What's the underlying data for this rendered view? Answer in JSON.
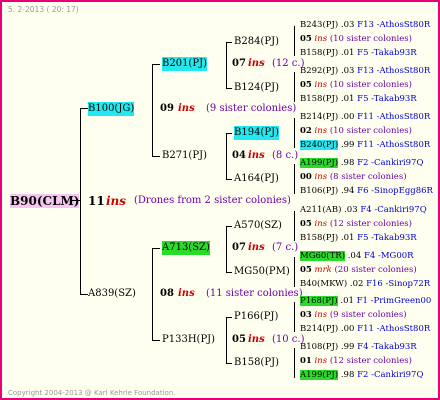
{
  "header": {
    "date": "5. 2-2013 ( 20: 17)"
  },
  "footer": {
    "copyright": "Copyright 2004-2013 @ Karl Kehrle Foundation."
  },
  "root": {
    "name": "B90(CLM)",
    "year": "11",
    "ins": "ins",
    "note": "(Drones from 2 sister colonies)"
  },
  "gen1": {
    "upper": {
      "name": "B100(JG)",
      "year": "09",
      "ins": "ins",
      "note": "(9 sister colonies)"
    },
    "lower": {
      "name": "A839(SZ)",
      "year": "08",
      "ins": "ins",
      "note": "(11 sister colonies)"
    }
  },
  "gen2": {
    "b201": {
      "name": "B201(PJ)",
      "year": "07",
      "ins": "ins",
      "note": "(12 c.)"
    },
    "b271": {
      "name": "B271(PJ)",
      "year": "04",
      "ins": "ins",
      "note": "(8 c.)"
    },
    "a713": {
      "name": "A713(SZ)",
      "year": "07",
      "ins": "ins",
      "note": "(7 c.)"
    },
    "p133": {
      "name": "P133H(PJ)",
      "year": "05",
      "ins": "ins",
      "note": "(10 c.)"
    }
  },
  "gen3": {
    "b284": "B284(PJ)",
    "b124": "B124(PJ)",
    "b194": "B194(PJ)",
    "a164": "A164(PJ)",
    "a570": "A570(SZ)",
    "mg50": "MG50(PM)",
    "p166": "P166(PJ)",
    "b158": "B158(PJ)"
  },
  "right": [
    {
      "a": "B243(PJ)",
      "b": ".03",
      "c": "F13 -AthosSt80R"
    },
    {
      "a": "05",
      "b": "ins",
      "c": "(10 sister colonies)"
    },
    {
      "a": "B158(PJ)",
      "b": ".01",
      "c": "F5 -Takab93R"
    },
    {
      "a": "B292(PJ)",
      "b": ".03",
      "c": "F13 -AthosSt80R"
    },
    {
      "a": "05",
      "b": "ins",
      "c": "(10 sister colonies)"
    },
    {
      "a": "B158(PJ)",
      "b": ".01",
      "c": "F5 -Takab93R"
    },
    {
      "a": "B214(PJ)",
      "b": ".00",
      "c": "F11 -AthosSt80R"
    },
    {
      "a": "02",
      "b": "ins",
      "c": "(10 sister colonies)"
    },
    {
      "a": "B240(PJ)",
      "b": ".99",
      "c": "F11 -AthosSt80R"
    },
    {
      "a": "A199(PJ)",
      "b": ".98",
      "c": "F2 -Cankiri97Q"
    },
    {
      "a": "00",
      "b": "ins",
      "c": "(8 sister colonies)"
    },
    {
      "a": "B106(PJ)",
      "b": ".94",
      "c": "F6 -SinopEgg86R"
    },
    {
      "a": "A211(AB)",
      "b": ".03",
      "c": "F4 -Cankiri97Q"
    },
    {
      "a": "05",
      "b": "ins",
      "c": "(12 sister colonies)"
    },
    {
      "a": "B158(PJ)",
      "b": ".01",
      "c": "F5 -Takab93R"
    },
    {
      "a": "MG60(TR)",
      "b": ".04",
      "c": "F4 -MG00R"
    },
    {
      "a": "05",
      "b": "mrk",
      "c": "(20 sister colonies)"
    },
    {
      "a": "B40(MKW)",
      "b": ".02",
      "c": "F16 -Sinop72R"
    },
    {
      "a": "P168(PJ)",
      "b": ".01",
      "c": "F1 -PrimGreen00"
    },
    {
      "a": "03",
      "b": "ins",
      "c": "(9 sister colonies)"
    },
    {
      "a": "B214(PJ)",
      "b": ".00",
      "c": "F11 -AthosSt80R"
    },
    {
      "a": "B108(PJ)",
      "b": ".99",
      "c": "F4 -Takab93R"
    },
    {
      "a": "01",
      "b": "ins",
      "c": "(12 sister colonies)"
    },
    {
      "a": "A199(PJ)",
      "b": ".98",
      "c": "F2 -Cankiri97Q"
    }
  ]
}
